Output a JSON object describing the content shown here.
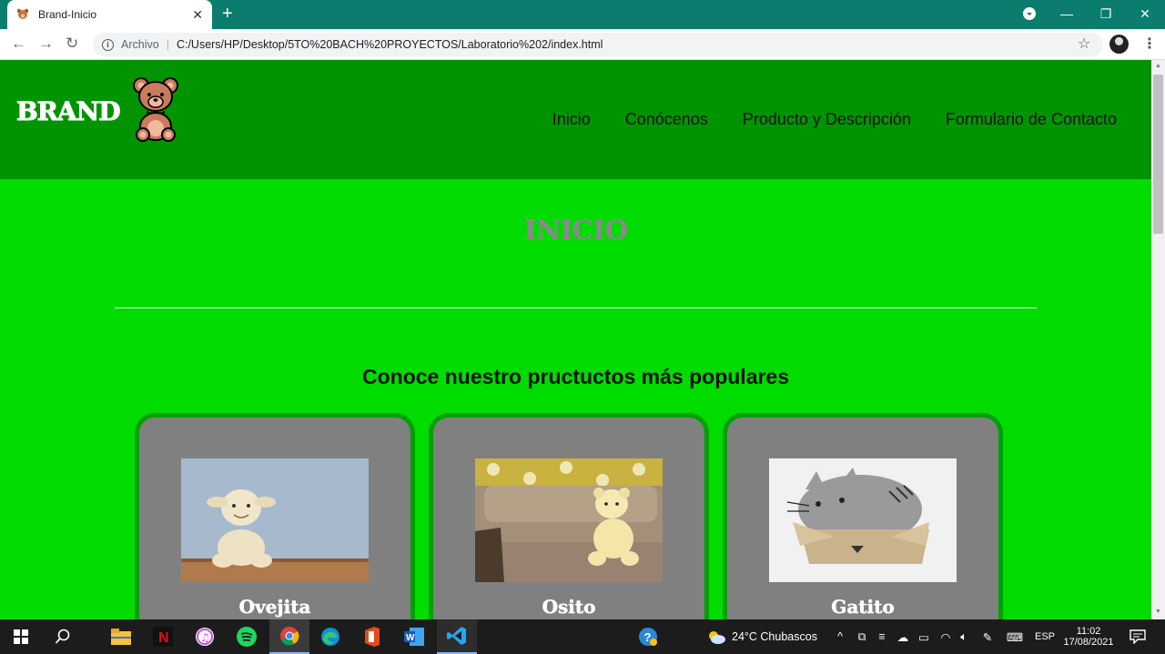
{
  "browser": {
    "tab_title": "Brand-Inicio",
    "tab_close": "✕",
    "new_tab": "+",
    "window_minimize": "—",
    "window_maximize": "❐",
    "window_close": "✕",
    "security_label": "Archivo",
    "url": "C:/Users/HP/Desktop/5TO%20BACH%20PROYECTOS/Laboratorio%202/index.html"
  },
  "site": {
    "brand": "BRAND",
    "nav": [
      "Inicio",
      "Conócenos",
      "Producto y Descripción",
      "Formulario de Contacto"
    ],
    "page_title": "INICIO",
    "subtitle": "Conoce nuestro pructuctos más populares",
    "products": [
      {
        "name": "Ovejita"
      },
      {
        "name": "Osito"
      },
      {
        "name": "Gatito"
      }
    ]
  },
  "taskbar": {
    "weather": "24°C  Chubascos",
    "language": "ESP",
    "time": "11:02",
    "date": "17/08/2021"
  },
  "colors": {
    "header": "#009400",
    "page_bg": "#00dc00",
    "card_bg": "#808080",
    "card_border": "#00a000",
    "title_bar": "#0b7d6f"
  }
}
